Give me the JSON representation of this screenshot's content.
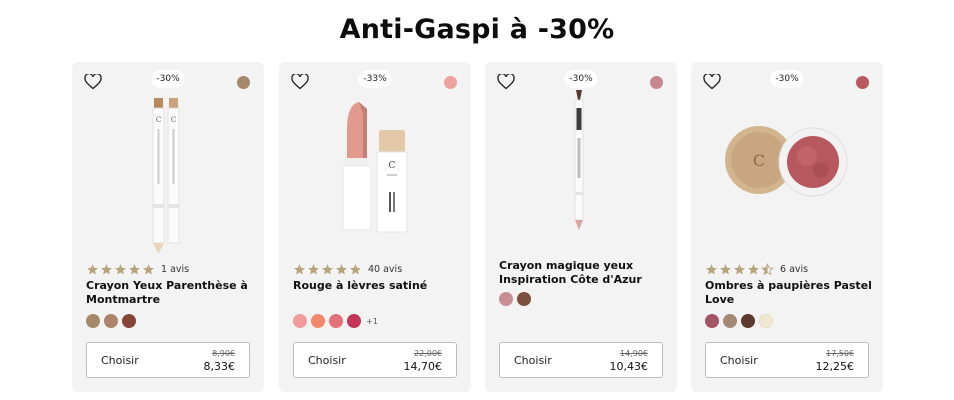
{
  "page_title": "Anti-Gaspi à -30%",
  "colors": {
    "star": "#b8a47a",
    "card_bg": "#f4f3f3"
  },
  "products": [
    {
      "discount": "-30%",
      "top_swatch": "#a5876a",
      "rating": "5",
      "reviews": "1 avis",
      "name": "Crayon Yeux Parenthèse à Montmartre",
      "swatches": [
        "#a48868",
        "#ae836c",
        "#86453a"
      ],
      "more": "",
      "button": "Choisir",
      "old_price": "8,90€",
      "new_price": "8,33€"
    },
    {
      "discount": "-33%",
      "top_swatch": "#eea1a1",
      "rating": "5",
      "reviews": "40 avis",
      "name": "Rouge à lèvres satiné",
      "swatches": [
        "#ee9c9c",
        "#f2876e",
        "#e4707a",
        "#c43556"
      ],
      "more": "+1",
      "button": "Choisir",
      "old_price": "22,00€",
      "new_price": "14,70€"
    },
    {
      "discount": "-30%",
      "top_swatch": "#c6878f",
      "rating": "",
      "reviews": "",
      "name": "Crayon magique yeux Inspiration Côte d'Azur",
      "swatches": [
        "#c78d92",
        "#7e503d"
      ],
      "more": "",
      "button": "Choisir",
      "old_price": "14,90€",
      "new_price": "10,43€"
    },
    {
      "discount": "-30%",
      "top_swatch": "#b8595f",
      "rating": "4.5",
      "reviews": "6 avis",
      "name": "Ombres à paupières Pastel Love",
      "swatches": [
        "#a45565",
        "#a48a76",
        "#5c3b2e",
        "#f1e8d2"
      ],
      "more": "",
      "button": "Choisir",
      "old_price": "17,50€",
      "new_price": "12,25€"
    }
  ]
}
